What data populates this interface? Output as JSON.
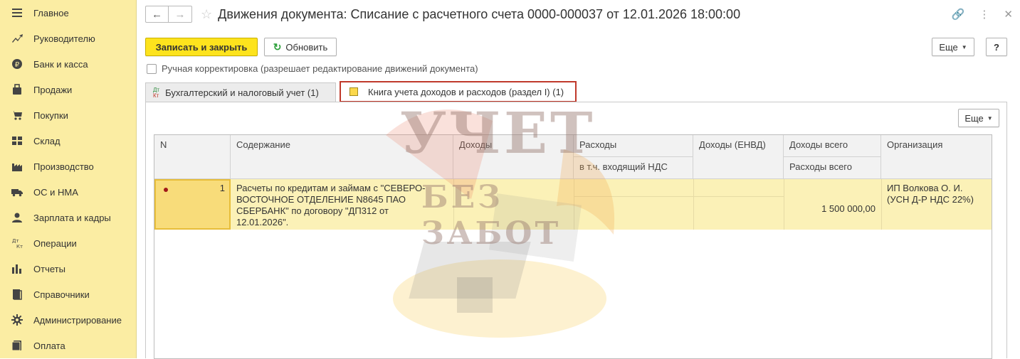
{
  "sidebar": {
    "items": [
      {
        "label": "Главное",
        "icon": "menu-icon"
      },
      {
        "label": "Руководителю",
        "icon": "trend-icon"
      },
      {
        "label": "Банк и касса",
        "icon": "ruble-icon"
      },
      {
        "label": "Продажи",
        "icon": "bag-icon"
      },
      {
        "label": "Покупки",
        "icon": "cart-icon"
      },
      {
        "label": "Склад",
        "icon": "warehouse-icon"
      },
      {
        "label": "Производство",
        "icon": "factory-icon"
      },
      {
        "label": "ОС и НМА",
        "icon": "truck-icon"
      },
      {
        "label": "Зарплата и кадры",
        "icon": "person-icon"
      },
      {
        "label": "Операции",
        "icon": "dt-kt-icon"
      },
      {
        "label": "Отчеты",
        "icon": "bar-chart-icon"
      },
      {
        "label": "Справочники",
        "icon": "book-icon"
      },
      {
        "label": "Администрирование",
        "icon": "gear-icon"
      },
      {
        "label": "Оплата",
        "icon": "card-icon"
      }
    ]
  },
  "header": {
    "title": "Движения документа: Списание с расчетного счета 0000-000037 от 12.01.2026 18:00:00"
  },
  "toolbar": {
    "save_close": "Записать и закрыть",
    "refresh": "Обновить",
    "more": "Еще",
    "help": "?"
  },
  "manual_correction": {
    "label": "Ручная корректировка (разрешает редактирование движений документа)",
    "checked": false
  },
  "tabs": [
    {
      "label": "Бухгалтерский и налоговый учет (1)",
      "icon_top": "Дт",
      "icon_bottom": "Кт"
    },
    {
      "label": "Книга учета доходов и расходов (раздел I) (1)",
      "active": true
    }
  ],
  "panel": {
    "more": "Еще"
  },
  "table": {
    "headers": {
      "n": "N",
      "content": "Содержание",
      "income": "Доходы",
      "expenses": "Расходы",
      "expenses_vat": "в т.ч. входящий НДС",
      "income_envd": "Доходы (ЕНВД)",
      "income_total": "Доходы всего",
      "expenses_total": "Расходы всего",
      "organization": "Организация"
    },
    "rows": [
      {
        "n": "1",
        "content": "Расчеты по кредитам и займам с \"СЕВЕРО-ВОСТОЧНОЕ ОТДЕЛЕНИЕ N8645 ПАО СБЕРБАНК\" по договору \"ДП312 от 12.01.2026\".",
        "income": "",
        "expenses": "",
        "expenses_vat": "",
        "income_envd": "",
        "income_total": "",
        "expenses_total": "1 500 000,00",
        "organization": "ИП Волкова О. И. (УСН Д-Р НДС 22%)"
      }
    ]
  },
  "watermark": {
    "line1": "УЧЕТ",
    "line2": "БЕЗ ЗАБОТ"
  },
  "colors": {
    "sidebar": "#fbeda3",
    "primary_button": "#fde31d",
    "selected_row": "#fbf1b7",
    "active_tab_border": "#c0392b"
  }
}
